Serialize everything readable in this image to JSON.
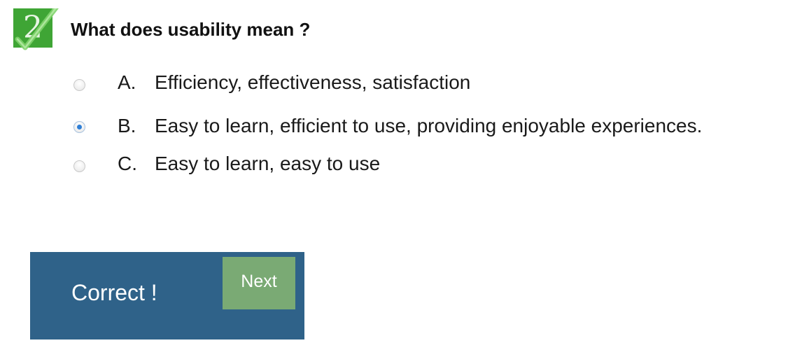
{
  "question": {
    "number": "2",
    "title": "What does usability mean ?"
  },
  "options": [
    {
      "letter": "A.",
      "text": "Efficiency, effectiveness, satisfaction",
      "selected": false
    },
    {
      "letter": "B.",
      "text": "Easy to learn, efficient to use, providing enjoyable experiences.",
      "selected": true
    },
    {
      "letter": "C.",
      "text": "Easy to learn, easy to use",
      "selected": false
    }
  ],
  "feedback": {
    "message": "Correct !",
    "next_label": "Next"
  },
  "colors": {
    "badge": "#3fa535",
    "feedback_bg": "#2f6289",
    "next_bg": "#7aaa74",
    "radio_selected": "#2f7fd6"
  }
}
